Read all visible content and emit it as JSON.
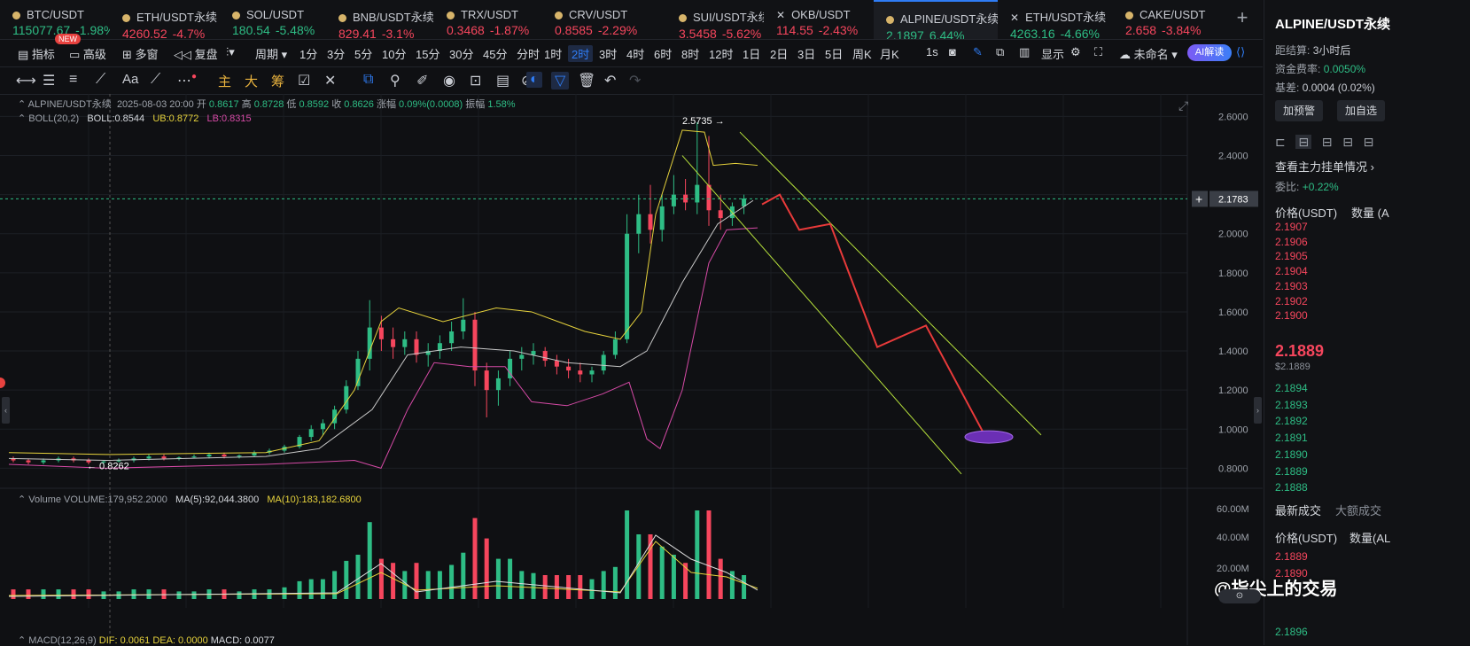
{
  "tickers": [
    {
      "name": "BTC/USDT",
      "price": "115077.67",
      "change": "-1.98%",
      "dir": "up",
      "icon": "dot-icon"
    },
    {
      "name": "ETH/USDT永续",
      "price": "4260.52",
      "change": "-4.7%",
      "dir": "down",
      "icon": "dot-icon"
    },
    {
      "name": "SOL/USDT",
      "price": "180.54",
      "change": "-5.48%",
      "dir": "up",
      "icon": "dot-icon"
    },
    {
      "name": "BNB/USDT永续",
      "price": "829.41",
      "change": "-3.1%",
      "dir": "down",
      "icon": "dot-icon"
    },
    {
      "name": "TRX/USDT",
      "price": "0.3468",
      "change": "-1.87%",
      "dir": "down",
      "icon": "dot-icon"
    },
    {
      "name": "CRV/USDT",
      "price": "0.8585",
      "change": "-2.29%",
      "dir": "down",
      "icon": "dot-icon"
    },
    {
      "name": "SUI/USDT永续",
      "price": "3.5458",
      "change": "-5.62%",
      "dir": "down",
      "icon": "dot-icon"
    },
    {
      "name": "OKB/USDT",
      "price": "114.55",
      "change": "-2.43%",
      "dir": "down",
      "icon": "x-icon"
    },
    {
      "name": "ALPINE/USDT永续",
      "price": "2.1897",
      "change": "6.44%",
      "dir": "up",
      "icon": "dot-icon",
      "active": true
    },
    {
      "name": "ETH/USDT永续",
      "price": "4263.16",
      "change": "-4.66%",
      "dir": "up",
      "icon": "x-icon"
    },
    {
      "name": "CAKE/USDT",
      "price": "2.658",
      "change": "-3.84%",
      "dir": "down",
      "icon": "dot-icon"
    }
  ],
  "toolbar": {
    "indicators": "指标",
    "new_badge": "NEW",
    "advanced": "高级",
    "multi": "多窗",
    "replay": "复盘",
    "period": "周期",
    "intervals": [
      "1分",
      "3分",
      "5分",
      "10分",
      "15分",
      "30分",
      "45分",
      "分时",
      "1时",
      "2时",
      "3时",
      "4时",
      "6时",
      "8时",
      "12时",
      "1日",
      "2日",
      "3日",
      "5日",
      "周K",
      "月K"
    ],
    "active_interval": "2时",
    "speed": "1s",
    "display": "显示",
    "unnamed": "未命名",
    "ai": "AI解读"
  },
  "drawtools": {
    "main": "主",
    "big": "大",
    "chips": "筹",
    "text": "Aa"
  },
  "legend": {
    "symbol": "ALPINE/USDT永续",
    "datetime": "2025-08-03 20:00",
    "open_label": "开",
    "open": "0.8617",
    "high_label": "高",
    "high": "0.8728",
    "low_label": "低",
    "low": "0.8592",
    "close_label": "收",
    "close": "0.8626",
    "chg_label": "涨幅",
    "chg": "0.09%(0.0008)",
    "amp_label": "振幅",
    "amp": "1.58%",
    "boll_name": "BOLL(20,2)",
    "boll": "BOLL:0.8544",
    "ub": "UB:0.8772",
    "lb": "LB:0.8315",
    "vol_name": "Volume",
    "vol": "VOLUME:179,952.2000",
    "ma5": "MA(5):92,044.3800",
    "ma10": "MA(10):183,182.6800",
    "macd_name": "MACD(12,26,9)",
    "dif": "DIF: 0.0061",
    "dea": "DEA: 0.0000",
    "macd": "MACD: 0.0077"
  },
  "chart_data": {
    "type": "candlestick",
    "price_axis": [
      "2.6000",
      "2.4000",
      "2.2000",
      "2.0000",
      "1.8000",
      "1.6000",
      "1.4000",
      "1.2000",
      "1.0000",
      "0.8000"
    ],
    "volume_axis": [
      "60.00M",
      "40.00M",
      "20.00M"
    ],
    "ylim": [
      0.72,
      2.67
    ],
    "current_price": "2.1783",
    "high_label": "2.5735",
    "low_label": "0.8262",
    "candles": [
      [
        0.85,
        0.86,
        0.83,
        0.84
      ],
      [
        0.84,
        0.85,
        0.82,
        0.83
      ],
      [
        0.83,
        0.85,
        0.82,
        0.84
      ],
      [
        0.84,
        0.86,
        0.83,
        0.85
      ],
      [
        0.85,
        0.86,
        0.83,
        0.84
      ],
      [
        0.84,
        0.85,
        0.82,
        0.83
      ],
      [
        0.83,
        0.84,
        0.82,
        0.835
      ],
      [
        0.835,
        0.85,
        0.83,
        0.84
      ],
      [
        0.84,
        0.86,
        0.83,
        0.85
      ],
      [
        0.85,
        0.87,
        0.84,
        0.86
      ],
      [
        0.86,
        0.87,
        0.84,
        0.85
      ],
      [
        0.85,
        0.86,
        0.84,
        0.855
      ],
      [
        0.855,
        0.87,
        0.85,
        0.86
      ],
      [
        0.86,
        0.88,
        0.85,
        0.87
      ],
      [
        0.87,
        0.88,
        0.85,
        0.86
      ],
      [
        0.86,
        0.87,
        0.85,
        0.865
      ],
      [
        0.865,
        0.89,
        0.86,
        0.88
      ],
      [
        0.88,
        0.9,
        0.87,
        0.89
      ],
      [
        0.89,
        0.92,
        0.88,
        0.91
      ],
      [
        0.91,
        0.97,
        0.9,
        0.96
      ],
      [
        0.96,
        1.02,
        0.94,
        1.0
      ],
      [
        1.0,
        1.05,
        0.97,
        1.03
      ],
      [
        1.03,
        1.12,
        1.0,
        1.1
      ],
      [
        1.1,
        1.25,
        1.08,
        1.22
      ],
      [
        1.22,
        1.4,
        1.2,
        1.36
      ],
      [
        1.36,
        1.66,
        1.3,
        1.52
      ],
      [
        1.52,
        1.58,
        1.4,
        1.46
      ],
      [
        1.46,
        1.52,
        1.36,
        1.42
      ],
      [
        1.42,
        1.5,
        1.38,
        1.46
      ],
      [
        1.46,
        1.5,
        1.34,
        1.38
      ],
      [
        1.38,
        1.44,
        1.32,
        1.4
      ],
      [
        1.4,
        1.48,
        1.36,
        1.44
      ],
      [
        1.44,
        1.55,
        1.4,
        1.5
      ],
      [
        1.5,
        1.67,
        1.46,
        1.56
      ],
      [
        1.56,
        1.6,
        1.22,
        1.3
      ],
      [
        1.3,
        1.34,
        1.06,
        1.2
      ],
      [
        1.2,
        1.3,
        1.12,
        1.26
      ],
      [
        1.26,
        1.4,
        1.22,
        1.36
      ],
      [
        1.36,
        1.42,
        1.3,
        1.38
      ],
      [
        1.38,
        1.44,
        1.33,
        1.4
      ],
      [
        1.4,
        1.42,
        1.32,
        1.35
      ],
      [
        1.35,
        1.38,
        1.28,
        1.32
      ],
      [
        1.32,
        1.36,
        1.26,
        1.3
      ],
      [
        1.3,
        1.34,
        1.24,
        1.28
      ],
      [
        1.28,
        1.32,
        1.24,
        1.3
      ],
      [
        1.3,
        1.4,
        1.28,
        1.38
      ],
      [
        1.38,
        1.5,
        1.36,
        1.46
      ],
      [
        1.46,
        2.1,
        1.44,
        2.0
      ],
      [
        2.0,
        2.2,
        1.9,
        2.1
      ],
      [
        2.1,
        2.25,
        1.95,
        2.02
      ],
      [
        2.02,
        2.2,
        1.96,
        2.14
      ],
      [
        2.14,
        2.3,
        2.1,
        2.2
      ],
      [
        2.2,
        2.28,
        2.12,
        2.16
      ],
      [
        2.16,
        2.57,
        2.1,
        2.25
      ],
      [
        2.25,
        2.5,
        2.04,
        2.12
      ],
      [
        2.12,
        2.2,
        2.02,
        2.08
      ],
      [
        2.08,
        2.16,
        2.04,
        2.14
      ],
      [
        2.14,
        2.2,
        2.1,
        2.18
      ]
    ]
  },
  "right": {
    "symbol": "ALPINE/USDT永续",
    "settle_label": "距结算:",
    "settle": "3小时后",
    "funding_label": "资金费率:",
    "funding": "0.0050%",
    "basis_label": "基差:",
    "basis": "0.0004 (0.02%)",
    "alert_btn": "加预警",
    "watch_btn": "加自选",
    "depth_link": "查看主力挂单情况",
    "ratio_label": "委比:",
    "ratio": "+0.22%",
    "price_col": "价格(USDT)",
    "qty_col": "数量 (A",
    "asks": [
      "2.1907",
      "2.1906",
      "2.1905",
      "2.1904",
      "2.1903",
      "2.1902",
      "2.1900"
    ],
    "last": "2.1889",
    "last_usd": "$2.1889",
    "bids": [
      "2.1894",
      "2.1893",
      "2.1892",
      "2.1891",
      "2.1890",
      "2.1889",
      "2.1888"
    ],
    "tab_trades": "最新成交",
    "tab_big": "大额成交",
    "trades_price_col": "价格(USDT)",
    "trades_qty_col": "数量(AL",
    "trades": [
      "2.1889",
      "2.1890"
    ],
    "trades_last": "2.1896",
    "watermark": "@指尖上的交易"
  },
  "colors": {
    "up": "#2ebd85",
    "down": "#f6465d",
    "accent": "#2f7df6"
  }
}
